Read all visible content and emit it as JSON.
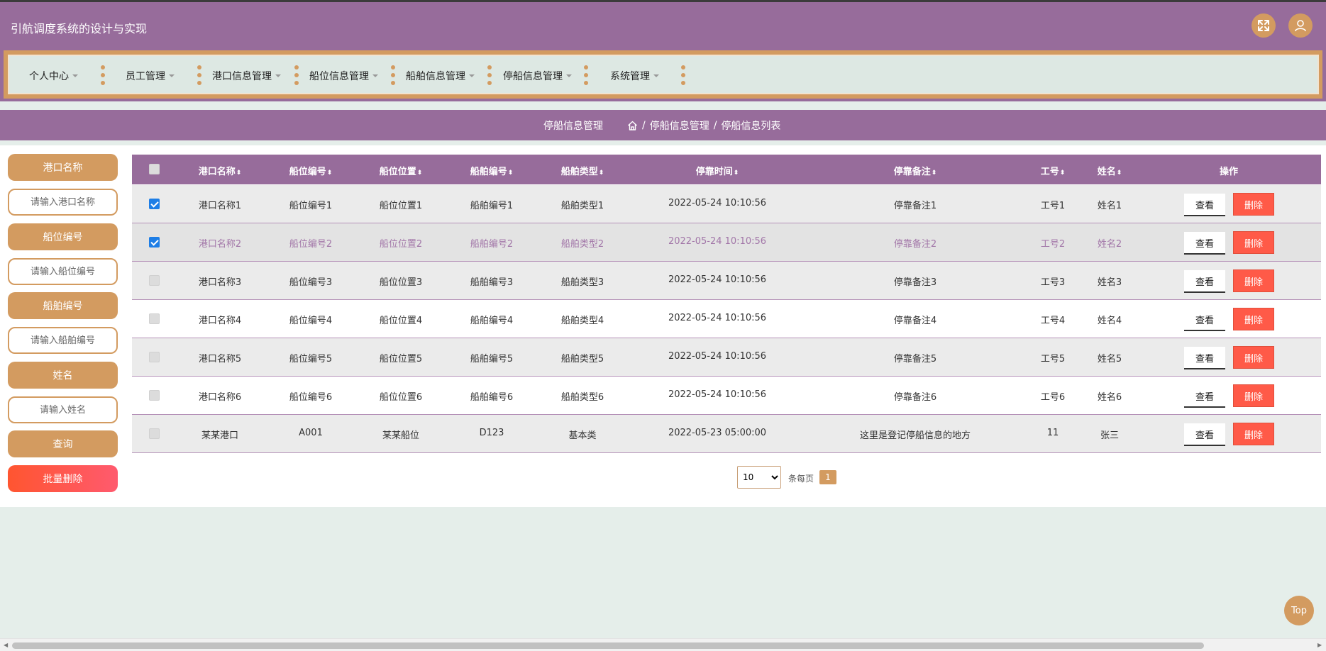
{
  "header": {
    "title": "引航调度系统的设计与实现"
  },
  "nav": {
    "items": [
      {
        "label": "个人中心"
      },
      {
        "label": "员工管理"
      },
      {
        "label": "港口信息管理"
      },
      {
        "label": "船位信息管理"
      },
      {
        "label": "船舶信息管理"
      },
      {
        "label": "停船信息管理"
      },
      {
        "label": "系统管理"
      }
    ]
  },
  "breadcrumb": {
    "title": "停船信息管理",
    "path": [
      "停船信息管理",
      "停船信息列表"
    ],
    "separator": "/"
  },
  "search": {
    "fields": [
      {
        "label": "港口名称",
        "placeholder": "请输入港口名称"
      },
      {
        "label": "船位编号",
        "placeholder": "请输入船位编号"
      },
      {
        "label": "船舶编号",
        "placeholder": "请输入船舶编号"
      },
      {
        "label": "姓名",
        "placeholder": "请输入姓名"
      }
    ],
    "query_label": "查询",
    "batch_delete_label": "批量删除"
  },
  "table": {
    "columns": [
      "港口名称",
      "船位编号",
      "船位位置",
      "船舶编号",
      "船舶类型",
      "停靠时间",
      "停靠备注",
      "工号",
      "姓名",
      "操作"
    ],
    "sort_glyph": "⬍",
    "view_label": "查看",
    "delete_label": "删除",
    "rows": [
      {
        "checked": true,
        "port": "港口名称1",
        "berth_no": "船位编号1",
        "berth_pos": "船位位置1",
        "ship_no": "船舶编号1",
        "ship_type": "船舶类型1",
        "time": "2022-05-24 10:10:56",
        "remark": "停靠备注1",
        "emp_no": "工号1",
        "name": "姓名1"
      },
      {
        "checked": true,
        "port": "港口名称2",
        "berth_no": "船位编号2",
        "berth_pos": "船位位置2",
        "ship_no": "船舶编号2",
        "ship_type": "船舶类型2",
        "time": "2022-05-24 10:10:56",
        "remark": "停靠备注2",
        "emp_no": "工号2",
        "name": "姓名2"
      },
      {
        "checked": false,
        "port": "港口名称3",
        "berth_no": "船位编号3",
        "berth_pos": "船位位置3",
        "ship_no": "船舶编号3",
        "ship_type": "船舶类型3",
        "time": "2022-05-24 10:10:56",
        "remark": "停靠备注3",
        "emp_no": "工号3",
        "name": "姓名3"
      },
      {
        "checked": false,
        "port": "港口名称4",
        "berth_no": "船位编号4",
        "berth_pos": "船位位置4",
        "ship_no": "船舶编号4",
        "ship_type": "船舶类型4",
        "time": "2022-05-24 10:10:56",
        "remark": "停靠备注4",
        "emp_no": "工号4",
        "name": "姓名4"
      },
      {
        "checked": false,
        "port": "港口名称5",
        "berth_no": "船位编号5",
        "berth_pos": "船位位置5",
        "ship_no": "船舶编号5",
        "ship_type": "船舶类型5",
        "time": "2022-05-24 10:10:56",
        "remark": "停靠备注5",
        "emp_no": "工号5",
        "name": "姓名5"
      },
      {
        "checked": false,
        "port": "港口名称6",
        "berth_no": "船位编号6",
        "berth_pos": "船位位置6",
        "ship_no": "船舶编号6",
        "ship_type": "船舶类型6",
        "time": "2022-05-24 10:10:56",
        "remark": "停靠备注6",
        "emp_no": "工号6",
        "name": "姓名6"
      },
      {
        "checked": false,
        "port": "某某港口",
        "berth_no": "A001",
        "berth_pos": "某某船位",
        "ship_no": "D123",
        "ship_type": "基本类",
        "time": "2022-05-23 05:00:00",
        "remark": "这里是登记停船信息的地方",
        "emp_no": "11",
        "name": "张三"
      }
    ]
  },
  "pagination": {
    "page_size": "10",
    "per_page_label": "条每页",
    "current_page": "1"
  },
  "top_button": "Top",
  "colors": {
    "primary": "#976c9b",
    "accent": "#d39b60",
    "danger": "#ff5a48"
  }
}
